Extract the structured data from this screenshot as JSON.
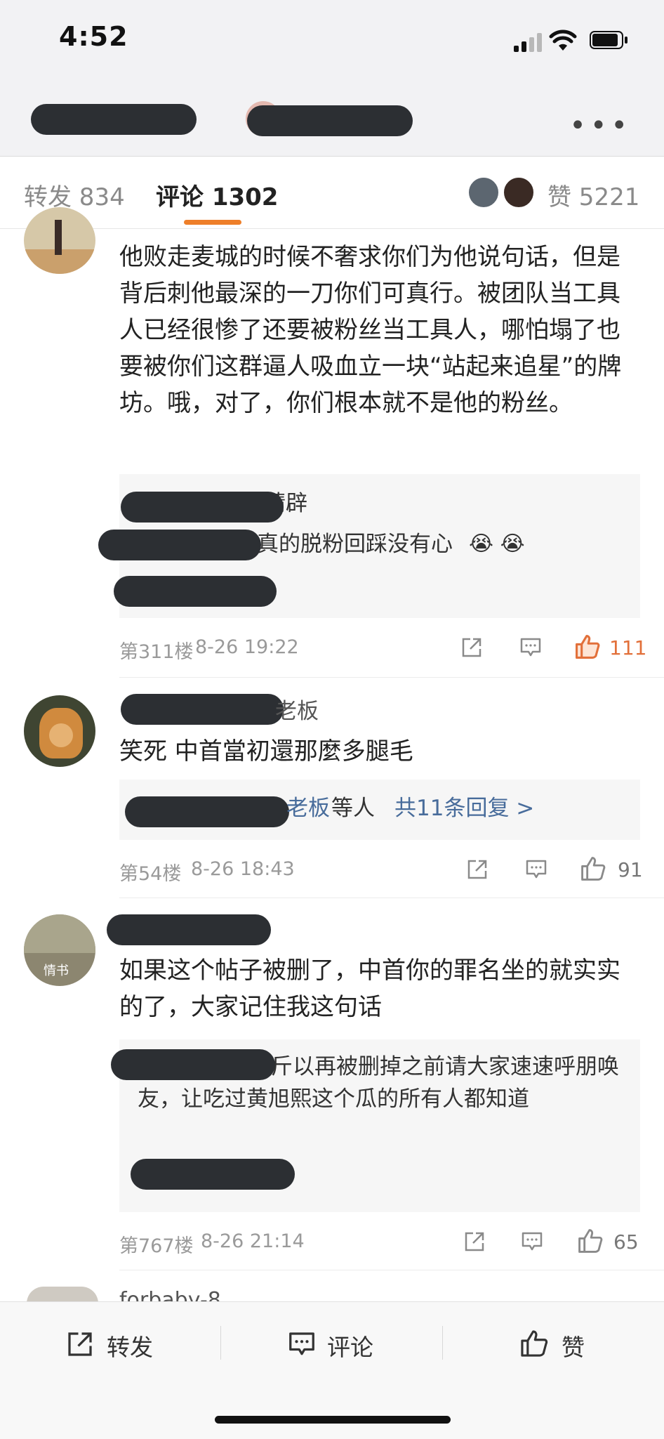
{
  "status_bar": {
    "time": "4:52"
  },
  "tabs": {
    "repost": "转发 834",
    "comment": "评论 1302",
    "like": "赞 5221"
  },
  "comments": [
    {
      "text": "他败走麦城的时候不奢求你们为他说句话，但是背后刺他最深的一刀你们可真行。被团队当工具人已经很惨了还要被粉丝当工具人，哪怕塌了也要被你们这群逼人吸血立一块“站起来追星”的牌坊。哦，对了，你们根本就不是他的粉丝。",
      "reply_line1_visible": "晴辟",
      "reply_line2_visible": "真的脱粉回踩没有心",
      "reply_emoji": "😭 😭",
      "floor": "第311楼",
      "date": "8-26 19:22",
      "likes": "111",
      "liked": true
    },
    {
      "name_visible": "老板",
      "text": "笑死 中首當初還那麼多腿毛",
      "reply_visible_link": "老板",
      "reply_suffix": "等人",
      "reply_more": "共11条回复 >",
      "floor": "第54楼",
      "date": "8-26 18:43",
      "likes": "91"
    },
    {
      "avatar_caption": "情书",
      "text": "如果这个帖子被删了，中首你的罪名坐的就实实的了，大家记住我这句话",
      "reply_visible": "斤以再被删掉之前请大家速速呼朋唤友，让吃过黄旭熙这个瓜的所有人都知道",
      "floor": "第767楼",
      "date": "8-26 21:14",
      "likes": "65"
    },
    {
      "name_visible": "forbaby-8"
    }
  ],
  "bottom_bar": {
    "repost": "转发",
    "comment": "评论",
    "like": "赞"
  },
  "colors": {
    "accent": "#ee7f2a",
    "link": "#486c9b",
    "like_active": "#e2703a"
  }
}
